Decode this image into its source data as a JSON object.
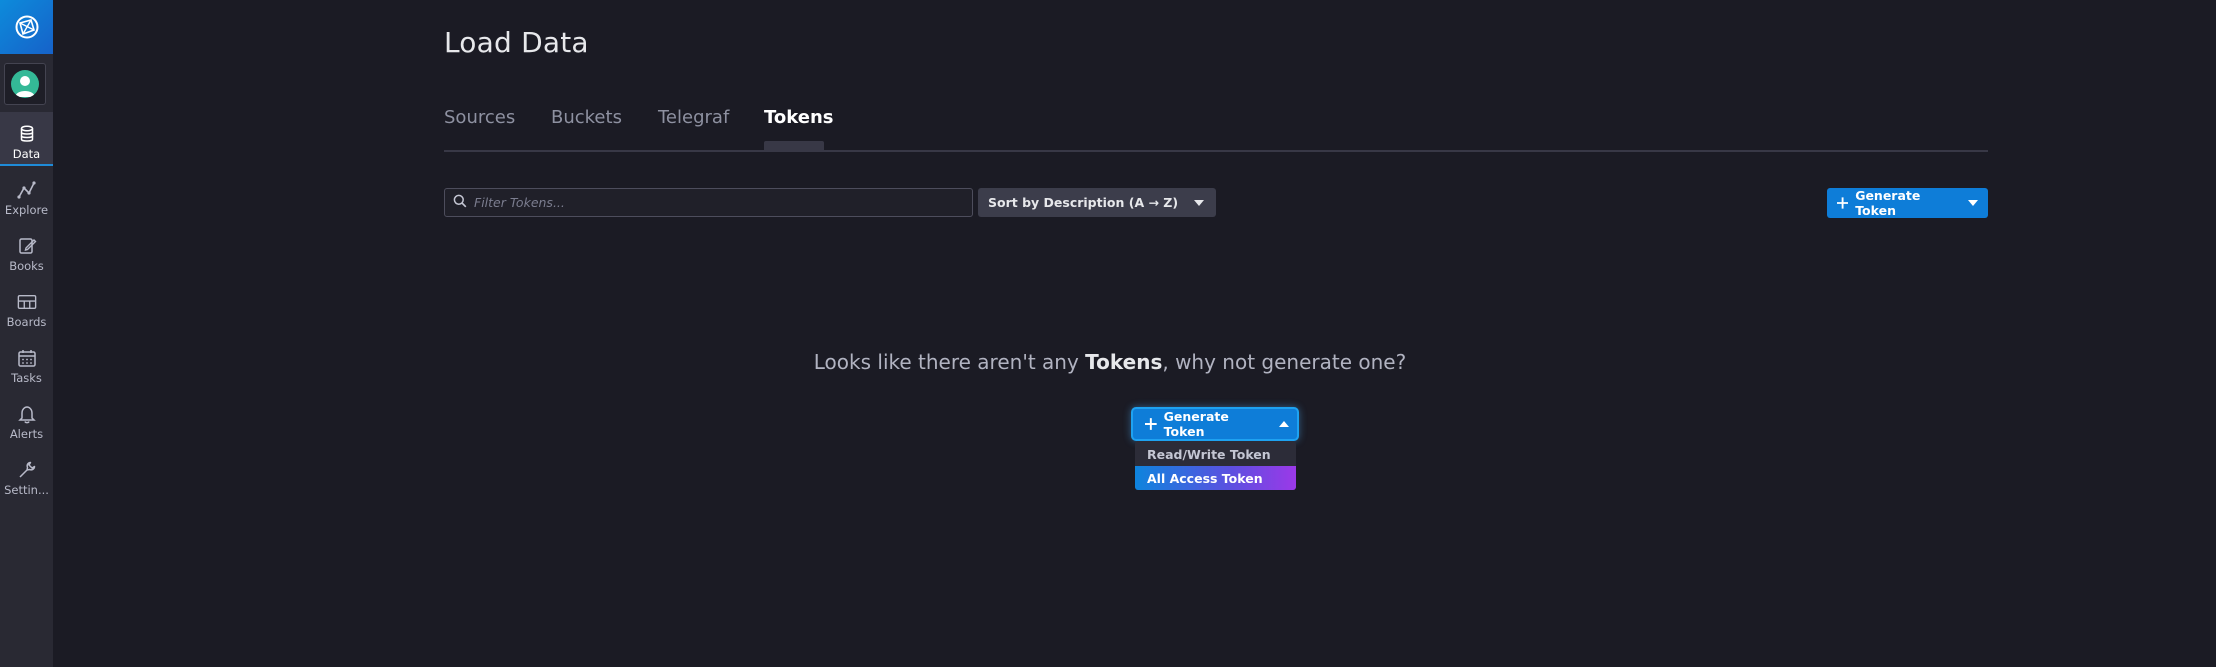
{
  "sidebar": {
    "items": [
      {
        "label": "Data",
        "icon": "database-icon",
        "active": true
      },
      {
        "label": "Explore",
        "icon": "graph-icon",
        "active": false
      },
      {
        "label": "Books",
        "icon": "notebook-icon",
        "active": false
      },
      {
        "label": "Boards",
        "icon": "dashboard-icon",
        "active": false
      },
      {
        "label": "Tasks",
        "icon": "calendar-icon",
        "active": false
      },
      {
        "label": "Alerts",
        "icon": "bell-icon",
        "active": false
      },
      {
        "label": "Settin...",
        "icon": "wrench-icon",
        "active": false
      }
    ]
  },
  "page": {
    "title": "Load Data"
  },
  "tabs": [
    {
      "label": "Sources",
      "active": false
    },
    {
      "label": "Buckets",
      "active": false
    },
    {
      "label": "Telegraf",
      "active": false
    },
    {
      "label": "Tokens",
      "active": true
    }
  ],
  "toolbar": {
    "filter_placeholder": "Filter Tokens...",
    "filter_value": "",
    "sort_label": "Sort by Description (A → Z)",
    "generate_label": "Generate Token"
  },
  "empty_state": {
    "prefix": "Looks like there aren't any ",
    "emphasis": "Tokens",
    "suffix": ", why not generate one?",
    "generate_label": "Generate Token",
    "menu": [
      {
        "label": "Read/Write Token",
        "highlighted": false
      },
      {
        "label": "All Access Token",
        "highlighted": true
      }
    ]
  },
  "colors": {
    "background": "#1b1b24",
    "sidebar": "#292933",
    "accent": "#0e7dd8",
    "menu_gradient_end": "#9b39e8"
  }
}
